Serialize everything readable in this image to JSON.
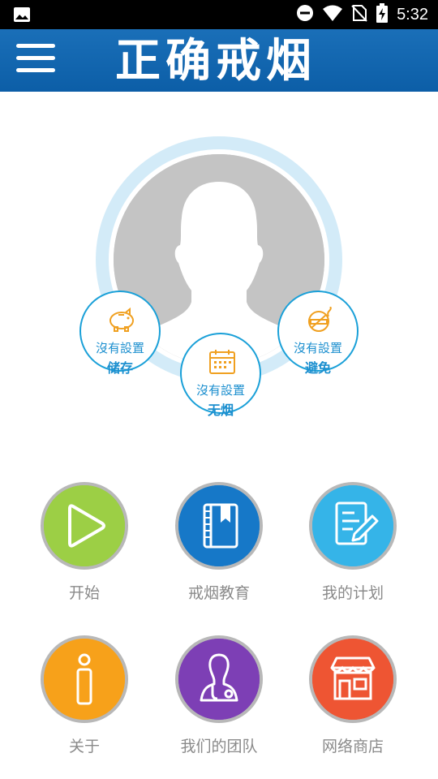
{
  "status_bar": {
    "time": "5:32",
    "icons": [
      "image-icon",
      "dnd-icon",
      "wifi-icon",
      "no-sim-icon",
      "battery-charging-icon"
    ]
  },
  "app_bar": {
    "title": "正确戒烟",
    "menu_icon": "hamburger-menu-icon",
    "color": "#0c5ea7"
  },
  "profile": {
    "avatar_icon": "default-avatar-silhouette-icon",
    "ring_color": "#d3ebf8",
    "badges": [
      {
        "value": "沒有設置",
        "label": "储存",
        "icon": "piggy-bank-icon"
      },
      {
        "value": "沒有設置",
        "label": "无烟",
        "icon": "calendar-icon"
      },
      {
        "value": "沒有設置",
        "label": "避免",
        "icon": "no-smoking-icon"
      }
    ],
    "badge_color": "#1aa0d8"
  },
  "menu": [
    {
      "label": "开始",
      "icon": "play-icon",
      "color": "#8cc63f"
    },
    {
      "label": "戒烟教育",
      "icon": "book-icon",
      "color": "#1678c8"
    },
    {
      "label": "我的计划",
      "icon": "plan-edit-icon",
      "color": "#35b4e8"
    },
    {
      "label": "关于",
      "icon": "info-icon",
      "color": "#f7a11a"
    },
    {
      "label": "我们的团队",
      "icon": "doctor-icon",
      "color": "#7b3fb2"
    },
    {
      "label": "网络商店",
      "icon": "store-icon",
      "color": "#ee5533"
    }
  ]
}
